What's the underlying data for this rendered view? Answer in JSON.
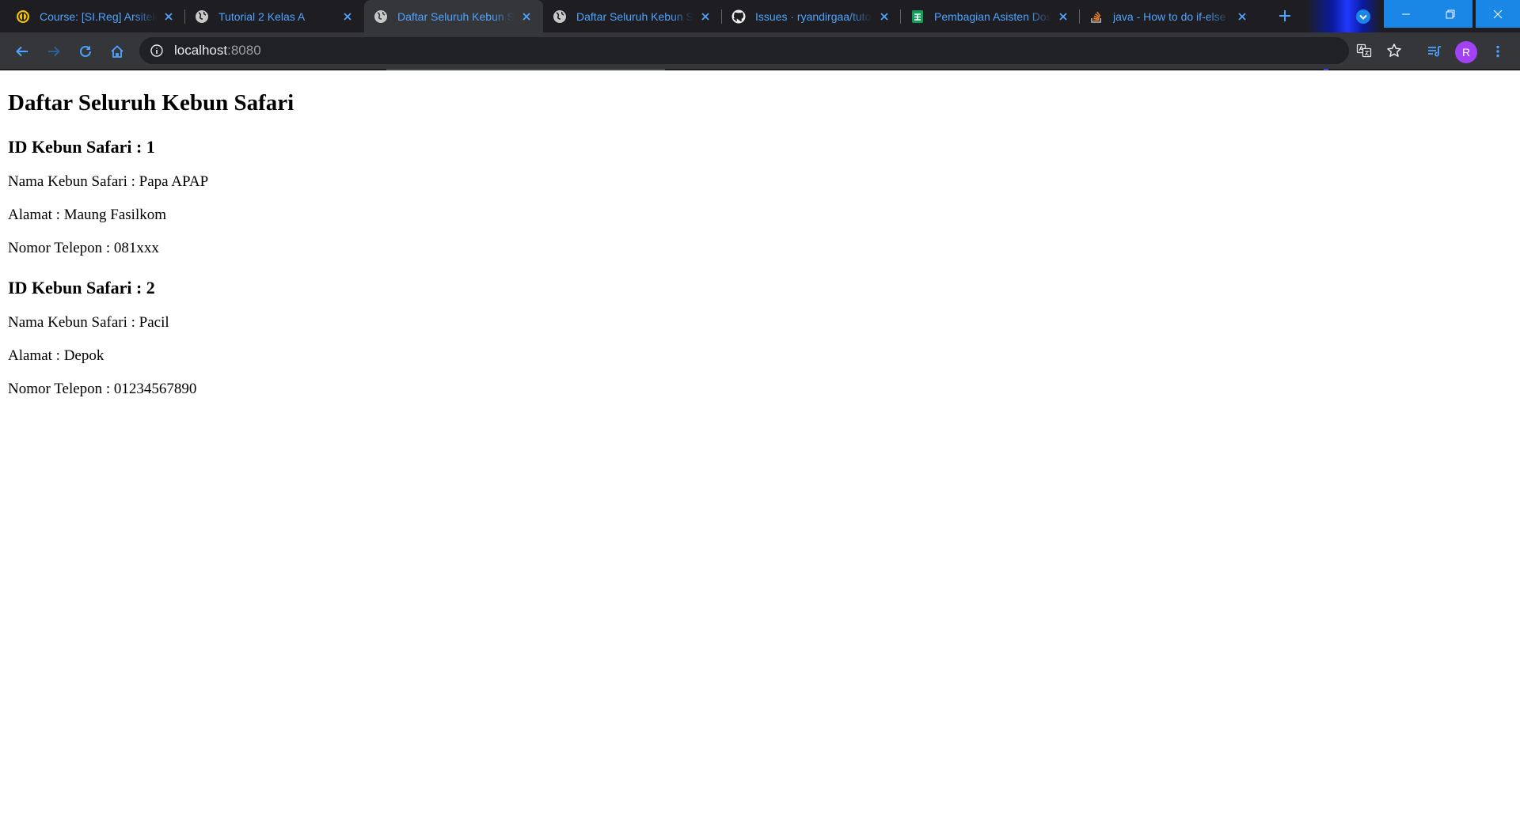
{
  "browser": {
    "tabs": [
      {
        "title": "Course: [SI.Reg] Arsitektur",
        "favicon": "ui-logo-icon",
        "active": false
      },
      {
        "title": "Tutorial 2 Kelas A",
        "favicon": "globe-icon",
        "active": false
      },
      {
        "title": "Daftar Seluruh Kebun Safari",
        "favicon": "globe-icon",
        "active": true
      },
      {
        "title": "Daftar Seluruh Kebun Safari",
        "favicon": "globe-icon",
        "active": false
      },
      {
        "title": "Issues · ryandirgaa/tutorial",
        "favicon": "github-icon",
        "active": false
      },
      {
        "title": "Pembagian Asisten Dosen",
        "favicon": "sheets-icon",
        "active": false
      },
      {
        "title": "java - How to do if-else",
        "favicon": "stackoverflow-icon",
        "active": false
      }
    ],
    "address": {
      "host": "localhost",
      "port": ":8080"
    },
    "profile_initial": "R",
    "accent_color": "#4ea3ff"
  },
  "page": {
    "heading": "Daftar Seluruh Kebun Safari",
    "items": [
      {
        "id_line": "ID Kebun Safari : 1",
        "nama": "Nama Kebun Safari : Papa APAP",
        "alamat": "Alamat : Maung Fasilkom",
        "telepon": "Nomor Telepon : 081xxx"
      },
      {
        "id_line": "ID Kebun Safari : 2",
        "nama": "Nama Kebun Safari : Pacil",
        "alamat": "Alamat : Depok",
        "telepon": "Nomor Telepon : 01234567890"
      }
    ]
  }
}
